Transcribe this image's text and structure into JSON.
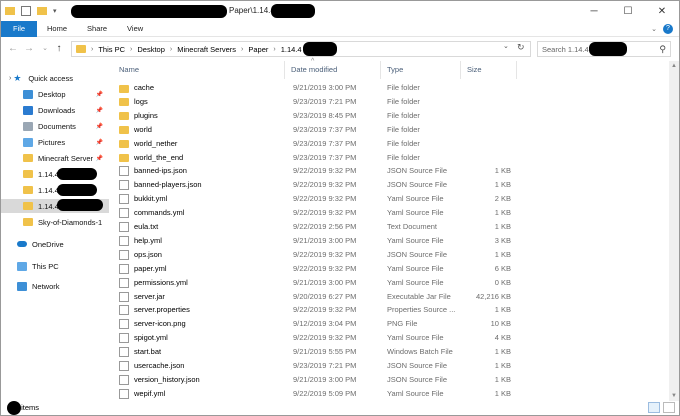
{
  "title": {
    "path_suffix": "Paper\\1.14.4"
  },
  "ribbon": {
    "tabs": [
      "File",
      "Home",
      "Share",
      "View"
    ]
  },
  "address": {
    "crumbs": [
      "This PC",
      "Desktop",
      "Minecraft Servers",
      "Paper",
      "1.14.4"
    ],
    "search_placeholder": "Search 1.14.4"
  },
  "nav": {
    "quick_access": "Quick access",
    "items": [
      {
        "label": "Desktop",
        "icon": "desktop-icon",
        "pinned": true
      },
      {
        "label": "Downloads",
        "icon": "downloads-icon",
        "pinned": true
      },
      {
        "label": "Documents",
        "icon": "documents-icon",
        "pinned": true
      },
      {
        "label": "Pictures",
        "icon": "pictures-icon",
        "pinned": true
      },
      {
        "label": "Minecraft Server",
        "icon": "folder-icon",
        "pinned": true
      },
      {
        "label": "1.14.4",
        "icon": "folder-icon",
        "pinned": false
      },
      {
        "label": "1.14.4",
        "icon": "folder-icon",
        "pinned": false
      },
      {
        "label": "1.14.4",
        "icon": "folder-icon",
        "pinned": false,
        "selected": true
      },
      {
        "label": "Sky-of-Diamonds-1",
        "icon": "folder-icon",
        "pinned": false
      }
    ],
    "onedrive": "OneDrive",
    "this_pc": "This PC",
    "network": "Network"
  },
  "columns": {
    "name": "Name",
    "date": "Date modified",
    "type": "Type",
    "size": "Size"
  },
  "files": [
    {
      "name": "cache",
      "date": "9/21/2019 3:00 PM",
      "type": "File folder",
      "size": "",
      "kind": "folder"
    },
    {
      "name": "logs",
      "date": "9/23/2019 7:21 PM",
      "type": "File folder",
      "size": "",
      "kind": "folder"
    },
    {
      "name": "plugins",
      "date": "9/23/2019 8:45 PM",
      "type": "File folder",
      "size": "",
      "kind": "folder"
    },
    {
      "name": "world",
      "date": "9/23/2019 7:37 PM",
      "type": "File folder",
      "size": "",
      "kind": "folder"
    },
    {
      "name": "world_nether",
      "date": "9/23/2019 7:37 PM",
      "type": "File folder",
      "size": "",
      "kind": "folder"
    },
    {
      "name": "world_the_end",
      "date": "9/23/2019 7:37 PM",
      "type": "File folder",
      "size": "",
      "kind": "folder"
    },
    {
      "name": "banned-ips.json",
      "date": "9/22/2019 9:32 PM",
      "type": "JSON Source File",
      "size": "1 KB",
      "kind": "file"
    },
    {
      "name": "banned-players.json",
      "date": "9/22/2019 9:32 PM",
      "type": "JSON Source File",
      "size": "1 KB",
      "kind": "file"
    },
    {
      "name": "bukkit.yml",
      "date": "9/22/2019 9:32 PM",
      "type": "Yaml Source File",
      "size": "2 KB",
      "kind": "file"
    },
    {
      "name": "commands.yml",
      "date": "9/22/2019 9:32 PM",
      "type": "Yaml Source File",
      "size": "1 KB",
      "kind": "file"
    },
    {
      "name": "eula.txt",
      "date": "9/22/2019 2:56 PM",
      "type": "Text Document",
      "size": "1 KB",
      "kind": "file"
    },
    {
      "name": "help.yml",
      "date": "9/21/2019 3:00 PM",
      "type": "Yaml Source File",
      "size": "3 KB",
      "kind": "file"
    },
    {
      "name": "ops.json",
      "date": "9/22/2019 9:32 PM",
      "type": "JSON Source File",
      "size": "1 KB",
      "kind": "file"
    },
    {
      "name": "paper.yml",
      "date": "9/22/2019 9:32 PM",
      "type": "Yaml Source File",
      "size": "6 KB",
      "kind": "file"
    },
    {
      "name": "permissions.yml",
      "date": "9/21/2019 3:00 PM",
      "type": "Yaml Source File",
      "size": "0 KB",
      "kind": "file"
    },
    {
      "name": "server.jar",
      "date": "9/20/2019 6:27 PM",
      "type": "Executable Jar File",
      "size": "42,216 KB",
      "kind": "file"
    },
    {
      "name": "server.properties",
      "date": "9/22/2019 9:32 PM",
      "type": "Properties Source ...",
      "size": "1 KB",
      "kind": "file"
    },
    {
      "name": "server-icon.png",
      "date": "9/12/2019 3:04 PM",
      "type": "PNG File",
      "size": "10 KB",
      "kind": "file"
    },
    {
      "name": "spigot.yml",
      "date": "9/22/2019 9:32 PM",
      "type": "Yaml Source File",
      "size": "4 KB",
      "kind": "file"
    },
    {
      "name": "start.bat",
      "date": "9/21/2019 5:55 PM",
      "type": "Windows Batch File",
      "size": "1 KB",
      "kind": "file"
    },
    {
      "name": "usercache.json",
      "date": "9/23/2019 7:21 PM",
      "type": "JSON Source File",
      "size": "1 KB",
      "kind": "file"
    },
    {
      "name": "version_history.json",
      "date": "9/21/2019 3:00 PM",
      "type": "JSON Source File",
      "size": "1 KB",
      "kind": "file"
    },
    {
      "name": "wepif.yml",
      "date": "9/22/2019 5:09 PM",
      "type": "Yaml Source File",
      "size": "1 KB",
      "kind": "file"
    }
  ],
  "status": {
    "items": "items"
  },
  "colors": {
    "accent": "#1979ca",
    "folder": "#f0c24a",
    "selected": "#d9d9d9"
  }
}
